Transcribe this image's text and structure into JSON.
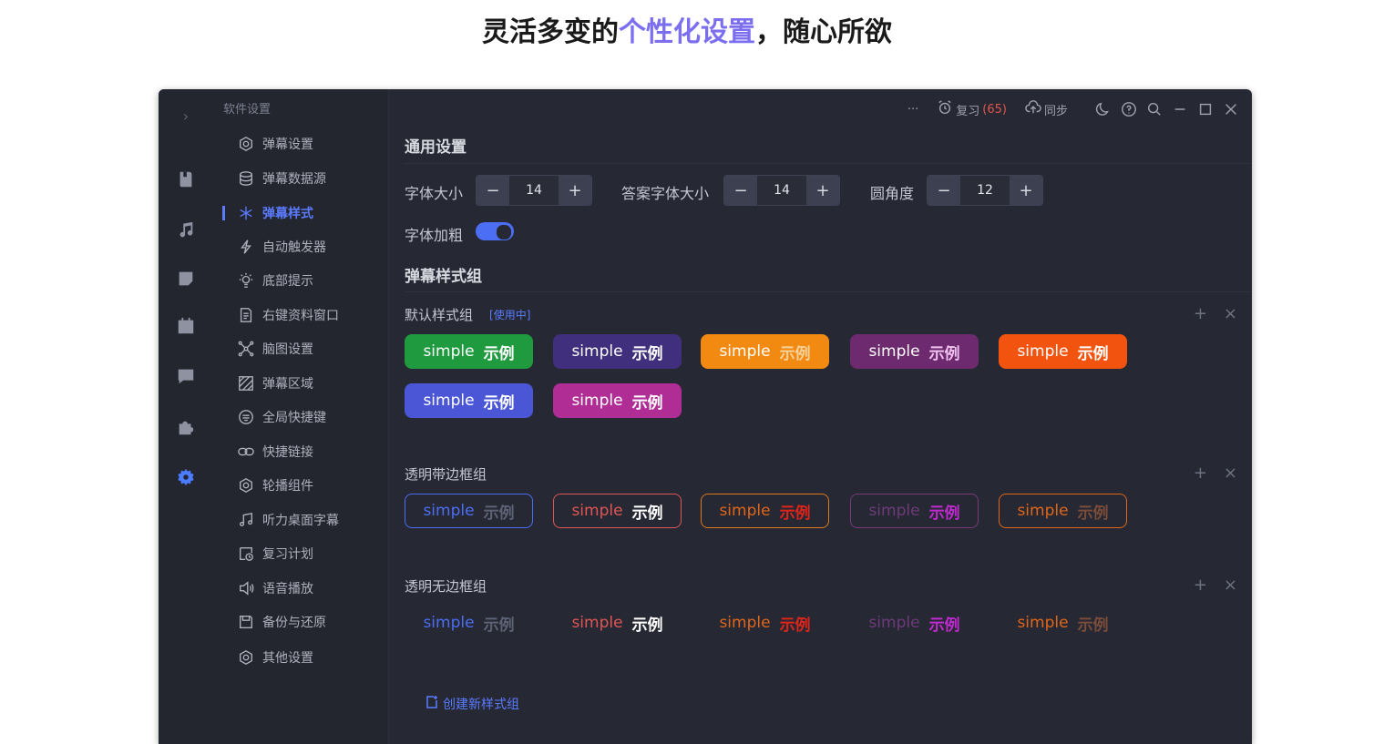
{
  "headline": {
    "part1": "灵活多变的",
    "highlight": "个性化设置",
    "part2": "，随心所欲"
  },
  "menu": {
    "title": "软件设置",
    "items": [
      {
        "label": "弹幕设置",
        "icon": "ring-icon"
      },
      {
        "label": "弹幕数据源",
        "icon": "database-icon"
      },
      {
        "label": "弹幕样式",
        "icon": "asterisk-icon"
      },
      {
        "label": "自动触发器",
        "icon": "lightning-icon"
      },
      {
        "label": "底部提示",
        "icon": "bulb-icon"
      },
      {
        "label": "右键资料窗口",
        "icon": "document-icon"
      },
      {
        "label": "脑图设置",
        "icon": "mindmap-icon"
      },
      {
        "label": "弹幕区域",
        "icon": "hatch-icon"
      },
      {
        "label": "全局快捷键",
        "icon": "keyboard-icon"
      },
      {
        "label": "快捷链接",
        "icon": "link-icon"
      },
      {
        "label": "轮播组件",
        "icon": "carousel-icon"
      },
      {
        "label": "听力桌面字幕",
        "icon": "music-icon"
      },
      {
        "label": "复习计划",
        "icon": "calendar-clock-icon"
      },
      {
        "label": "语音播放",
        "icon": "speaker-icon"
      },
      {
        "label": "备份与还原",
        "icon": "save-icon"
      },
      {
        "label": "其他设置",
        "icon": "ring-icon"
      }
    ]
  },
  "topbar": {
    "more": "···",
    "review_label": "复习",
    "review_count": "(65)",
    "sync_label": "同步"
  },
  "general": {
    "title": "通用设置",
    "font_size_label": "字体大小",
    "font_size": "14",
    "answer_font_size_label": "答案字体大小",
    "answer_font_size": "14",
    "radius_label": "圆角度",
    "radius": "12",
    "bold_label": "字体加粗",
    "bold_on": true,
    "minus": "−",
    "plus": "+"
  },
  "style_groups_title": "弹幕样式组",
  "groups": [
    {
      "name": "默认样式组",
      "badge": "[使用中]"
    },
    {
      "name": "透明带边框组",
      "badge": ""
    },
    {
      "name": "透明无边框组",
      "badge": ""
    }
  ],
  "chip_text": {
    "en": "simple",
    "zh": "示例"
  },
  "group_actions": {
    "add": "+",
    "close": "×"
  },
  "create_label": "创建新样式组",
  "colors": {
    "accent": "#5b7cff",
    "filled": [
      "#1f9a3f",
      "#3f2f7d",
      "#f28a12",
      "#6d2a6e",
      "#f25410",
      "#4a56d6",
      "#b12d96"
    ],
    "filled_zh": [
      "#ffffff",
      "#ffffff",
      "#f6d29a",
      "#f0c1f0",
      "#ffffff",
      "#ffffff",
      "#ffffff"
    ],
    "outline_border": [
      "#4c6ef5",
      "#e05555",
      "#e0791a",
      "#7a3a7a",
      "#e0661a"
    ],
    "outline_en": [
      "#4c6ef5",
      "#e05555",
      "#e0661a",
      "#6d3b7a",
      "#e0661a"
    ],
    "outline_zh": [
      "#5d6275",
      "#ffffff",
      "#e0241a",
      "#c02ad0",
      "#7b4c3a"
    ]
  }
}
